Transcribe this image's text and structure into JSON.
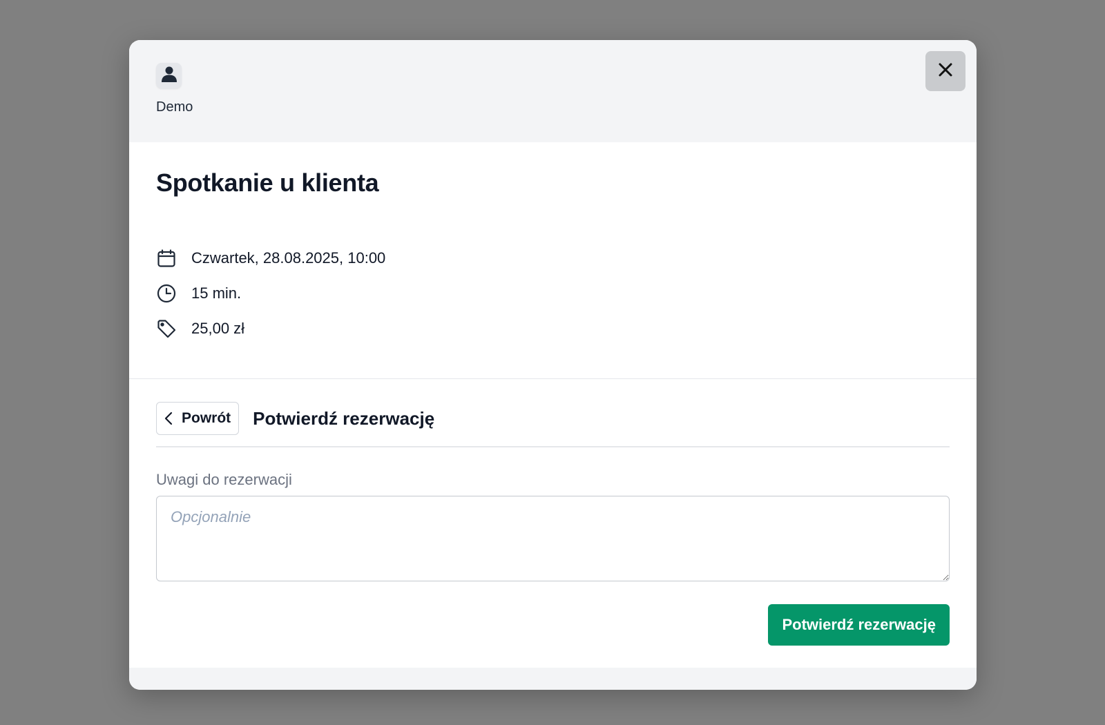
{
  "header": {
    "org_name": "Demo",
    "avatar_icon": "user-icon",
    "close_icon": "close-icon"
  },
  "event": {
    "title": "Spotkanie u klienta",
    "details": [
      {
        "icon": "calendar-icon",
        "text": "Czwartek, 28.08.2025, 10:00"
      },
      {
        "icon": "clock-icon",
        "text": "15 min."
      },
      {
        "icon": "tag-icon",
        "text": "25,00 zł"
      }
    ]
  },
  "step": {
    "back_label": "Powrót",
    "title": "Potwierdź rezerwację"
  },
  "form": {
    "notes_label": "Uwagi do rezerwacji",
    "notes_placeholder": "Opcjonalnie",
    "notes_value": "",
    "confirm_label": "Potwierdź rezerwację"
  },
  "colors": {
    "overlay": "#808080",
    "accent": "#059669",
    "header_bg": "#f3f4f6"
  }
}
